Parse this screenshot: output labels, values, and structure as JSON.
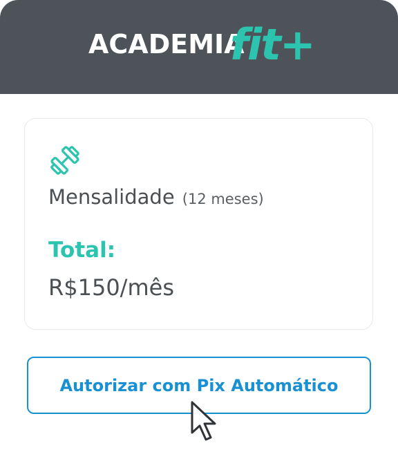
{
  "brand": {
    "wordmark": "ACADEMIA",
    "suffix": "fit+",
    "accent_color": "#2cc4ae",
    "header_bg": "#4d5359"
  },
  "plan": {
    "icon": "dumbbell-icon",
    "name": "Mensalidade",
    "duration": "(12 meses)",
    "total_label": "Total:",
    "total_value": "R$150/mês"
  },
  "actions": {
    "authorize_label": "Autorizar com Pix Automático",
    "button_color": "#1a90d4"
  },
  "cursor": {
    "icon": "mouse-pointer-icon"
  }
}
